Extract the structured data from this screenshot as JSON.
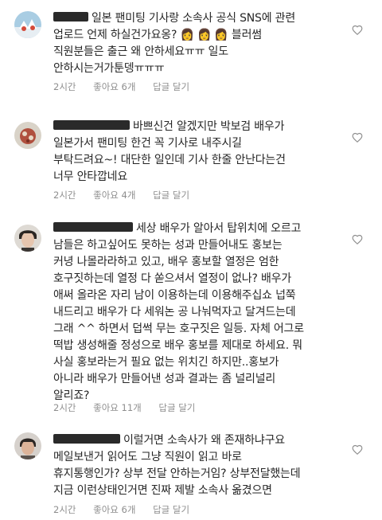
{
  "comments": [
    {
      "lines": [
        "일본 팬미팅 기사랑 소속사 공식 SNS에 관련",
        "업로드 언제 하실건가요옹? 👩 👩 👩  블러썸",
        "직원분들은 출근 왜 안하세요ㅠㅠ 일도",
        "안하시는거가툰뎅ㅠㅠㅠ"
      ],
      "time": "2시간",
      "likes": "좋아요 6개",
      "reply": "답글 달기",
      "avatar_colors": [
        "#9fc4dd",
        "#e9eef2",
        "#d44a3a"
      ]
    },
    {
      "lines": [
        "바쁘신건 알겠지만 박보검 배우가",
        "일본가서 팬미팅 한건 꼭 기사로 내주시길",
        "부탁드려요~! 대단한 일인데 기사 한줄 안난다는건",
        "너무 안타깝네요"
      ],
      "time": "2시간",
      "likes": "좋아요 4개",
      "reply": "답글 달기",
      "avatar_colors": [
        "#c9c3b6",
        "#a94a3a",
        "#e6dfd3"
      ]
    },
    {
      "lines": [
        "세상 배우가 알아서 탑위치에 오르고",
        "남들은 하고싶어도 못하는 성과 만들어내도 홍보는",
        "커녕 나몰라라하고 있고, 배우 홍보할 열정은 엄한",
        "호구짓하는데 열정 다 쏟으셔서 열정이 없나? 배우가",
        "애써 올라온 자리 남이 이용하는데 이용해주십쇼 넙쭉",
        "내드리고 배우가 다 세워논 공 나눠먹자고 달겨드는데",
        "그래 ^^ 하면서 덥썩 무는 호구짓은 일등. 자체 어그로",
        "떡밥 생성해줄 정성으로 배우 홍보를 제대로 하세요. 뭐",
        "사실 홍보라는거 필요 없는 위치긴 하지만..홍보가",
        "아니라 배우가 만들어낸 성과 결과는 좀 널리널리",
        "알리죠?"
      ],
      "time": "2시간",
      "likes": "좋아요 11개",
      "reply": "답글 달기",
      "avatar_colors": [
        "#d8d5d0",
        "#2b2623",
        "#c9a48c"
      ]
    },
    {
      "lines": [
        "이럴거면 소속사가 왜 존재하냐구요",
        "메일보낸거 읽어도 그냥 직원이 읽고 바로",
        "휴지통행인가? 상부 전달 안하는거임? 상부전달했는데",
        "지금 이런상태인거면 진짜 제발 소속사 옮겼으면"
      ],
      "time": "2시간",
      "likes": "좋아요 6개",
      "reply": "답글 달기",
      "avatar_colors": [
        "#cfcac6",
        "#2c2724",
        "#caa18a"
      ]
    }
  ]
}
